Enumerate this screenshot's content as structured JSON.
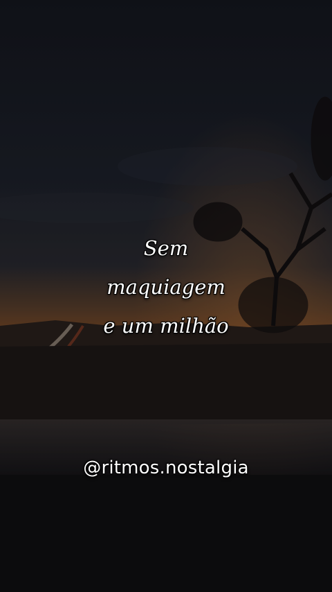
{
  "video_caption": {
    "lines": [
      "Sem",
      "maquiagem",
      "e um milhão"
    ]
  },
  "watermark": {
    "handle": "@ritmos.nostalgia"
  },
  "colors": {
    "sky_top": "#15171f",
    "sunset_glow": "#7a4a28",
    "caption_text": "#ffffff"
  }
}
